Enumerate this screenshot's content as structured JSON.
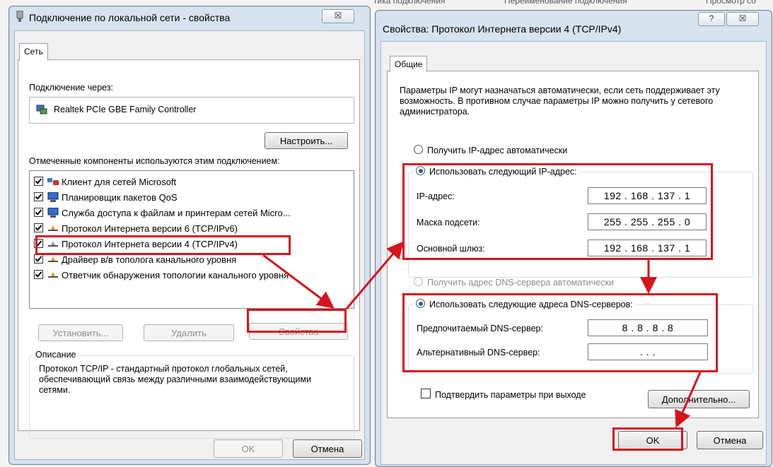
{
  "background_titles": [
    "тика подключения",
    "Переименование подключения",
    "Просмотр со"
  ],
  "left_window": {
    "title": "Подключение по локальной сети - свойства",
    "close_label": "☒",
    "tab": "Сеть",
    "connect_via_label": "Подключение через:",
    "adapter_name": "Realtek PCIe GBE Family Controller",
    "configure_button": "Настроить...",
    "components_label": "Отмеченные компоненты используются этим подключением:",
    "components": [
      {
        "label": "Клиент для сетей Microsoft",
        "icon": "network-client-icon"
      },
      {
        "label": "Планировщик пакетов QoS",
        "icon": "computer-icon"
      },
      {
        "label": "Служба доступа к файлам и принтерам сетей Micro...",
        "icon": "computer-icon"
      },
      {
        "label": "Протокол Интернета версии 6 (TCP/IPv6)",
        "icon": "protocol-icon"
      },
      {
        "label": "Протокол Интернета версии 4 (TCP/IPv4)",
        "icon": "protocol-icon"
      },
      {
        "label": "Драйвер в/в тополога канального уровня",
        "icon": "protocol-icon"
      },
      {
        "label": "Ответчик обнаружения топологии канального уровня",
        "icon": "protocol-icon"
      }
    ],
    "install_button": "Установить...",
    "remove_button": "Удалить",
    "properties_button": "Свойства",
    "description_title": "Описание",
    "description_text": "Протокол TCP/IP - стандартный протокол глобальных сетей, обеспечивающий связь между различными взаимодействующими сетями.",
    "ok_button": "OK",
    "cancel_button": "Отмена"
  },
  "right_window": {
    "title": "Свойства: Протокол Интернета версии 4 (TCP/IPv4)",
    "help_label": "?",
    "close_label": "☒",
    "tab": "Общие",
    "intro_text": "Параметры IP могут назначаться автоматически, если сеть поддерживает эту возможность. В противном случае параметры IP можно получить у сетевого администратора.",
    "auto_ip_label": "Получить IP-адрес автоматически",
    "manual_ip_label": "Использовать следующий IP-адрес:",
    "ip_label": "IP-адрес:",
    "ip_value": "192 . 168 . 137 .  1",
    "mask_label": "Маска подсети:",
    "mask_value": "255 . 255 . 255 .  0",
    "gateway_label": "Основной шлюз:",
    "gateway_value": "192 . 168 . 137 .  1",
    "auto_dns_label": "Получить адрес DNS-сервера автоматически",
    "manual_dns_label": "Использовать следующие адреса DNS-серверов:",
    "preferred_dns_label": "Предпочитаемый DNS-сервер:",
    "preferred_dns_value": "8  .  8  .  8  .  8",
    "alternate_dns_label": "Альтернативный DNS-сервер:",
    "alternate_dns_value": ".       .       .",
    "validate_label": "Подтвердить параметры при выходе",
    "advanced_button": "Дополнительно...",
    "ok_button": "OK",
    "cancel_button": "Отмена"
  },
  "colors": {
    "highlight": "#d6141c",
    "radio_accent": "#2a5ea8"
  }
}
